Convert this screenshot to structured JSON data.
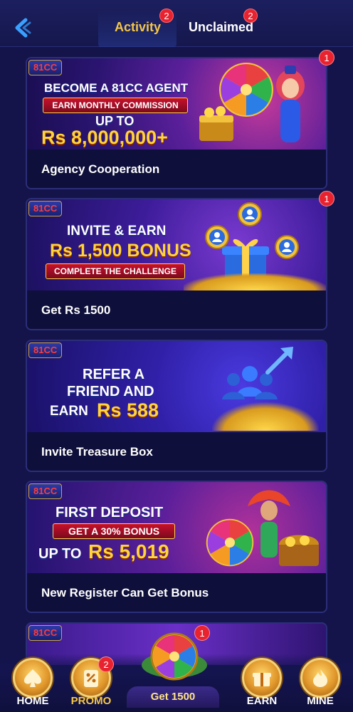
{
  "header": {
    "tabs": [
      {
        "label": "Activity",
        "badge": "2",
        "active": true
      },
      {
        "label": "Unclaimed",
        "badge": "2",
        "active": false
      }
    ],
    "accent_color": "#f4c64a"
  },
  "cards": [
    {
      "title": "Agency Cooperation",
      "badge": "1",
      "brand": {
        "a": "81CC",
        "b": ""
      },
      "banner": {
        "line1": "BECOME A 81CC AGENT",
        "ribbon": "EARN MONTHLY COMMISSION",
        "line2": "UP TO",
        "line3": "Rs 8,000,000+"
      }
    },
    {
      "title": "Get Rs 1500",
      "badge": "1",
      "brand": {
        "a": "81CC",
        "b": ""
      },
      "banner": {
        "line1": "INVITE & EARN",
        "line2": "Rs 1,500 BONUS",
        "ribbon": "COMPLETE THE CHALLENGE"
      }
    },
    {
      "title": "Invite Treasure Box",
      "badge": "",
      "brand": {
        "a": "81CC",
        "b": ""
      },
      "banner": {
        "line1": "REFER A",
        "line2": "FRIEND AND",
        "line3a": "EARN",
        "line3b": "Rs 588"
      }
    },
    {
      "title": "New Register Can Get Bonus",
      "badge": "",
      "brand": {
        "a": "81CC",
        "b": ""
      },
      "banner": {
        "line1": "FIRST DEPOSIT",
        "ribbon": "GET A 30% BONUS",
        "line3a": "UP TO",
        "line3b": "Rs 5,019"
      }
    }
  ],
  "bottom_nav": {
    "items": [
      {
        "label": "HOME",
        "icon": "spade-icon",
        "active": false
      },
      {
        "label": "PROMO",
        "icon": "promo-icon",
        "badge": "2",
        "active": true
      },
      {
        "label": "EARN",
        "icon": "gift-icon",
        "active": false
      },
      {
        "label": "MINE",
        "icon": "flame-icon",
        "active": false
      }
    ],
    "center": {
      "label": "Get 1500",
      "badge": "1",
      "icon": "wheel-icon"
    }
  }
}
